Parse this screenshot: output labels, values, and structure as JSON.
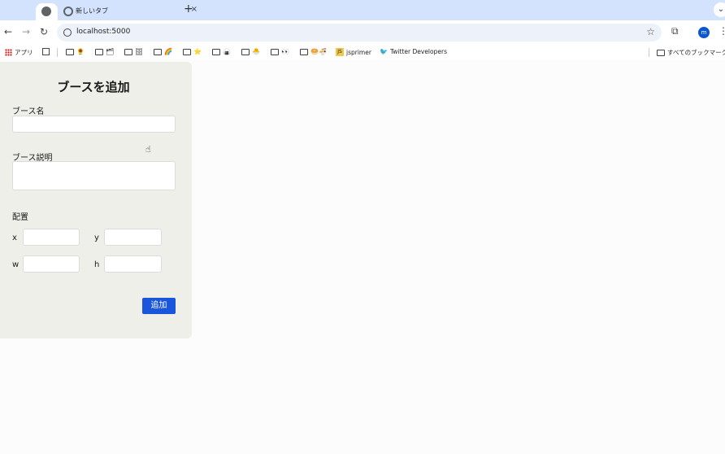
{
  "browser": {
    "tab_title": "新しいタブ",
    "tab_close": "×",
    "new_tab": "+",
    "url": "localhost:5000",
    "avatar_letter": "m",
    "bookmarks": {
      "apps_label": "アプリ",
      "items": [
        {
          "icon": "folder-icon",
          "emoji": "🌻"
        },
        {
          "icon": "folder-icon",
          "emoji": "🗂"
        },
        {
          "icon": "folder-icon",
          "emoji": "🗄"
        },
        {
          "icon": "folder-icon",
          "emoji": "🌈"
        },
        {
          "icon": "folder-icon",
          "emoji": "⭐"
        },
        {
          "icon": "folder-icon",
          "emoji": "🍙"
        },
        {
          "icon": "folder-icon",
          "emoji": "🐣"
        },
        {
          "icon": "folder-icon",
          "emoji": "👀"
        },
        {
          "icon": "folder-icon",
          "emoji": "🥯🍜"
        }
      ],
      "jsprimer_label": "jsprimer",
      "jsprimer_badge": "JS",
      "twitter_label": "Twitter Developers",
      "all_bookmarks_label": "すべてのブックマーク"
    }
  },
  "form": {
    "title": "ブースを追加",
    "name_label": "ブース名",
    "name_value": "",
    "description_label": "ブース説明",
    "description_value": "",
    "placement_label": "配置",
    "x_label": "x",
    "y_label": "y",
    "w_label": "w",
    "h_label": "h",
    "submit_label": "追加"
  }
}
